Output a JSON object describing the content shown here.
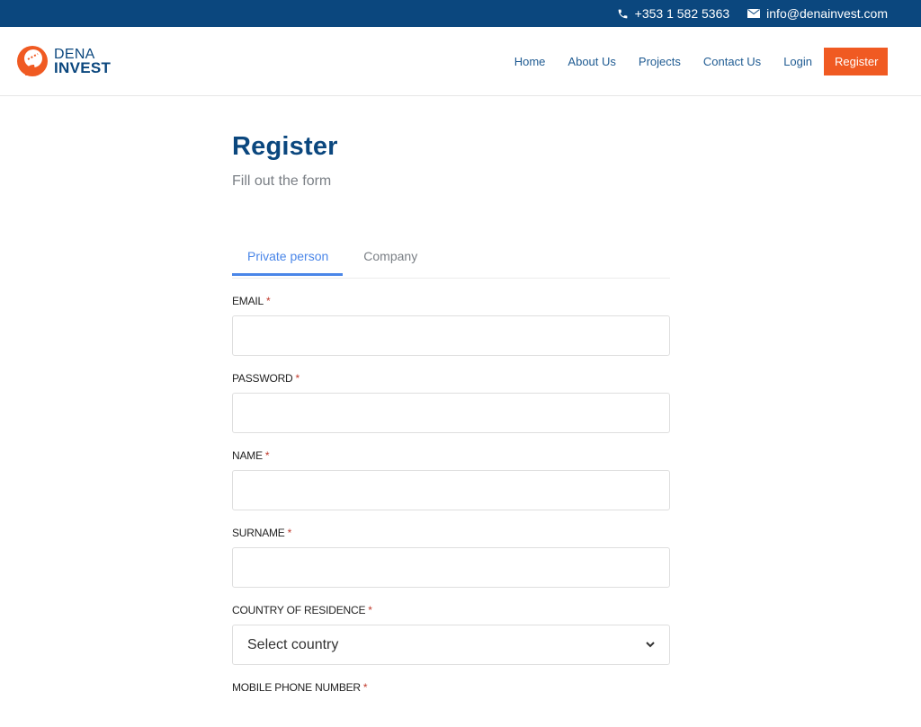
{
  "topbar": {
    "phone": "+353 1 582 5363",
    "email": "info@denainvest.com",
    "phone_icon": "phone-icon",
    "email_icon": "envelope-icon"
  },
  "brand": {
    "line1": "DENA",
    "line2": "INVEST",
    "colors": {
      "primary": "#0b477e",
      "accent": "#f05a22"
    }
  },
  "nav": {
    "items": [
      "Home",
      "About Us",
      "Projects",
      "Contact Us",
      "Login"
    ],
    "register_label": "Register"
  },
  "page": {
    "title": "Register",
    "subtitle": "Fill out the form"
  },
  "tabs": [
    {
      "label": "Private person",
      "active": true
    },
    {
      "label": "Company",
      "active": false
    }
  ],
  "form": {
    "required_marker": "*",
    "fields": [
      {
        "label": "EMAIL",
        "value": "",
        "placeholder": ""
      },
      {
        "label": "PASSWORD",
        "value": "",
        "placeholder": ""
      },
      {
        "label": "NAME",
        "value": "",
        "placeholder": ""
      },
      {
        "label": "SURNAME",
        "value": "",
        "placeholder": ""
      },
      {
        "label": "COUNTRY OF RESIDENCE",
        "selected": "Select country"
      },
      {
        "label": "MOBILE PHONE NUMBER"
      }
    ]
  }
}
